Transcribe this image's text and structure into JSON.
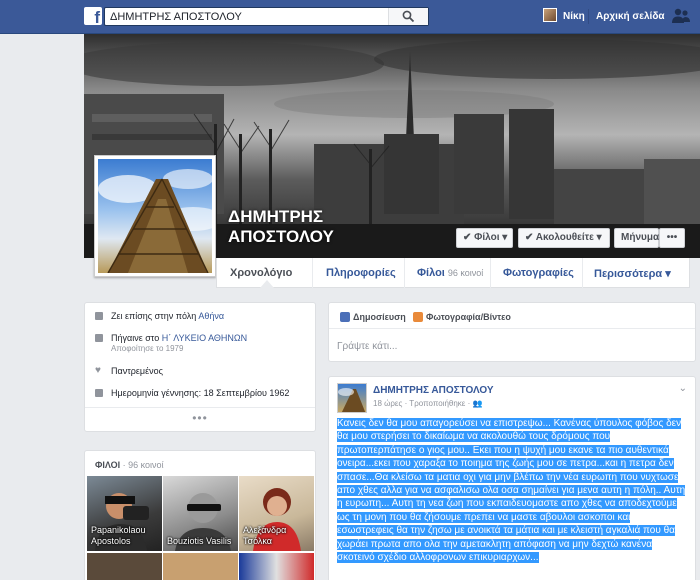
{
  "topbar": {
    "search_value": "ΔΗΜΗΤΡΗΣ ΑΠΟΣΤΟΛΟΥ",
    "user_name": "Νίκη",
    "home_label": "Αρχική σελίδα"
  },
  "profile": {
    "name_line1": "ΔΗΜΗΤΡΗΣ",
    "name_line2": "ΑΠΟΣΤΟΛΟΥ",
    "buttons": {
      "friends": "✔ Φίλοι ▾",
      "following": "✔ Ακολουθείτε ▾",
      "message": "Μήνυμα",
      "more": "•••"
    }
  },
  "nav": {
    "tabs": [
      {
        "label": "Χρονολόγιο"
      },
      {
        "label": "Πληροφορίες"
      },
      {
        "label": "Φίλοι",
        "count": "96 κοινοί"
      },
      {
        "label": "Φωτογραφίες"
      },
      {
        "label": "Περισσότερα ▾"
      }
    ]
  },
  "intro": {
    "lives_prefix": "Ζει επίσης στην πόλη ",
    "lives_city": "Αθήνα",
    "school_prefix": "Πήγαινε στο ",
    "school_name": "Η΄ ΛΥΚΕΙΟ ΑΘΗΝΩΝ",
    "school_sub": "Αποφοίτησε το 1979",
    "relationship": "Παντρεμένος",
    "birthday": "Ημερομηνία γέννησης: 18 Σεπτεμβρίου 1962",
    "more": "•••"
  },
  "friends_card": {
    "title": "ΦΙΛΟΙ",
    "count": " · 96 κοινοί",
    "friends": [
      {
        "name": "Papanikolaou Apostolos"
      },
      {
        "name": "Bouziotis Vasilis"
      },
      {
        "name": "Αλεξάνδρα Τσόλκα"
      }
    ]
  },
  "composer": {
    "tab_post": "Δημοσίευση",
    "tab_photo": "Φωτογραφία/Βίντεο",
    "placeholder": "Γράψτε κάτι..."
  },
  "post": {
    "author": "ΔΗΜΗΤΡΗΣ ΑΠΟΣΤΟΛΟΥ",
    "meta": "18 ώρες · Τροποποιήθηκε ·",
    "text": "Κανεις δεν θα μου απαγορεύσει να επιστρεψω... Κανένας ύπουλος φόβος δεν θα μου στερήσει το δικαίωμα να ακολουθώ τους δρόμους που πρωτοπερπάτησε ο γιος μου.. Εκει που η ψυχή μου εκανε τα πιο αυθεντικά ονειρα...εκει που χαραξα το ποιημα της ζωής μου σε πετρα...και η πετρα δεν σπασε...Θα κλείσω τα ματια οχι για μην βλέπω την νέα ευρωπη που νυχτωσε απο χθες αλλα για να ασφαλισω ολα οσα σημαίνει για μενα αυτη η πόλη.. Αυτη η ευρωπη... Αυτη τη νεα ζωη που εκπαιδευομαστε απο χθες να αποδεχτούμε ως τη μονη που θα ζήσουμε πρεπει να μαστε αβουλοι ασκοποι και εσωστρεφεις θα την ζησω με ανοικτά τα μάτια και με κλειστή αγκαλιά που θα χωράει πρωτα απο ολα την αμετακλητη απόφαση να μην δεχτώ κανένα σκοτεινό σχέδιο αλλοφρονων επικυριαρχων..."
  },
  "colors": {
    "fb_blue": "#3b5998",
    "link": "#365899",
    "selection": "#3399ff",
    "page_bg": "#e9ebee"
  }
}
